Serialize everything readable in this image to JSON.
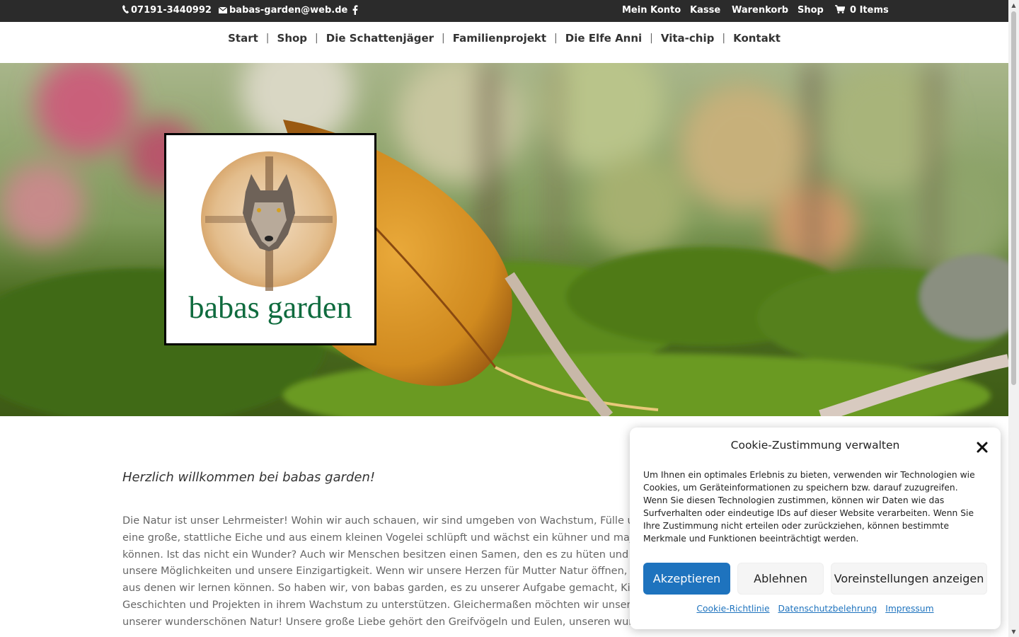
{
  "topbar": {
    "phone": "07191-3440992",
    "email": "babas-garden@web.de",
    "facebook_icon": "facebook-icon",
    "links": [
      "Mein Konto",
      "Kasse",
      "Warenkorb",
      "Shop"
    ],
    "cart": "0 Items"
  },
  "nav": {
    "items": [
      "Start",
      "Shop",
      "Die Schattenjäger",
      "Familienprojekt",
      "Die Elfe Anni",
      "Vita-chip",
      "Kontakt"
    ],
    "separator": "|"
  },
  "logo": {
    "text": "babas garden"
  },
  "content": {
    "welcome": "Herzlich willkommen bei babas garden!",
    "lines": [
      "Die Natur ist unser Lehrmeister! Wohin wir auch schauen, wir sind umgeben von Wachstum, Fülle und",
      "eine große, stattliche Eiche und aus einem kleinen Vogelei schlüpft und wächst ein kühner und majest",
      "können. Ist das nicht ein Wunder? Auch wir Menschen besitzen einen Samen, den es zu hüten und zu",
      "unsere Möglichkeiten und unsere Einzigartigkeit. Wenn wir unsere Herzen für Mutter Natur öffnen, seh",
      "aus denen wir lernen können. So  haben wir, von babas garden, es zu unserer Aufgabe gemacht, Kind",
      "Geschichten und Projekten in ihrem Wachstum zu unterstützen. Gleichermaßen möchten wir unsere Ti",
      "unserer wunderschönen Natur! Unsere große Liebe gehört den Greifvögeln und Eulen, unseren wunde"
    ]
  },
  "cookie": {
    "title": "Cookie-Zustimmung verwalten",
    "close_icon": "close-icon",
    "text": "Um Ihnen ein optimales Erlebnis zu bieten, verwenden wir Technologien wie Cookies, um Geräteinformationen zu speichern bzw. darauf zuzugreifen. Wenn Sie diesen Technologien zustimmen, können wir Daten wie das Surfverhalten oder eindeutige IDs auf dieser Website verarbeiten. Wenn Sie Ihre Zustimmung nicht erteilen oder zurückziehen, können bestimmte Merkmale und Funktionen beeinträchtigt werden.",
    "accept": "Akzeptieren",
    "deny": "Ablehnen",
    "prefs": "Voreinstellungen anzeigen",
    "links": [
      "Cookie-Richtlinie",
      "Datenschutzbelehrung",
      "Impressum"
    ],
    "accent_color": "#1e73be"
  }
}
